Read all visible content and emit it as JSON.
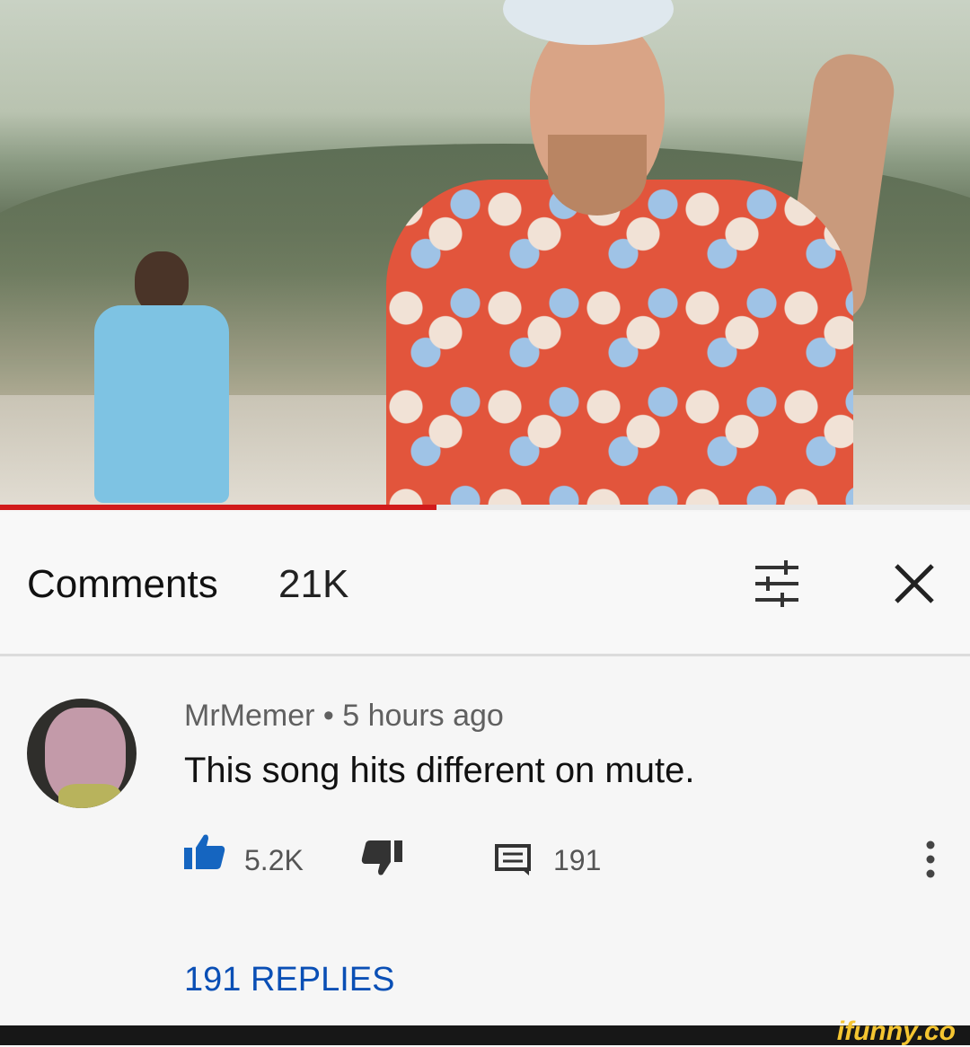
{
  "video": {
    "progress_fraction": 0.45
  },
  "comments_header": {
    "title": "Comments",
    "count": "21K"
  },
  "comment": {
    "author": "MrMemer",
    "separator": " • ",
    "time": "5 hours ago",
    "text": "This song hits different on mute.",
    "likes": "5.2K",
    "reply_count": "191",
    "replies_link": "191 REPLIES"
  },
  "icons": {
    "sort": "sort-filter-icon",
    "close": "close-icon",
    "like": "thumbs-up-icon",
    "dislike": "thumbs-down-icon",
    "reply": "comment-icon",
    "more": "more-vertical-icon"
  },
  "colors": {
    "accent_red": "#d11b1b",
    "like_blue": "#1565c0",
    "link_blue": "#0a4fb5",
    "watermark": "#f4c531"
  },
  "watermark": "ifunny.co"
}
